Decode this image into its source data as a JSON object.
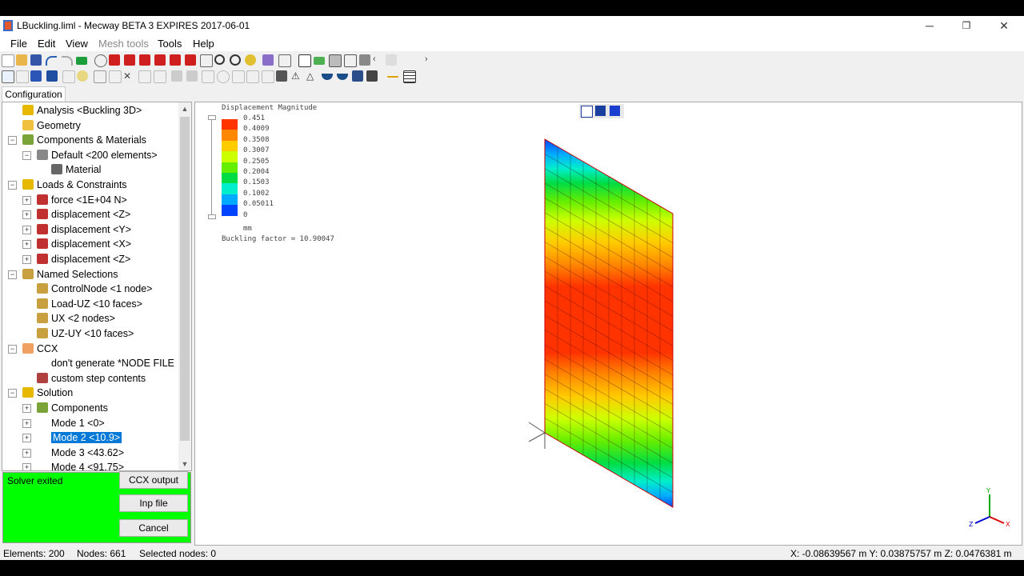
{
  "titlebar": {
    "title": "LBuckling.liml - Mecway BETA 3 EXPIRES 2017-06-01",
    "minimize": "─",
    "maximize": "❐",
    "close": "✕"
  },
  "menu": [
    "File",
    "Edit",
    "View",
    "Mesh tools",
    "Tools",
    "Help"
  ],
  "panel_tab": "Configuration",
  "tree": [
    {
      "label": "Analysis <Buckling 3D>",
      "icon": "analysis-icon"
    },
    {
      "label": "Geometry",
      "icon": "folder-icon"
    },
    {
      "label": "Components & Materials",
      "icon": "components-icon"
    },
    {
      "label": "Default <200 elements>",
      "icon": "component-icon"
    },
    {
      "label": "Material",
      "icon": "material-icon"
    },
    {
      "label": "Loads & Constraints",
      "icon": "loads-icon"
    },
    {
      "label": "force <1E+04 N>",
      "icon": "force-icon"
    },
    {
      "label": "displacement <Z>",
      "icon": "displacement-icon"
    },
    {
      "label": "displacement <Y>",
      "icon": "displacement-icon"
    },
    {
      "label": "displacement <X>",
      "icon": "displacement-icon"
    },
    {
      "label": "displacement <Z>",
      "icon": "displacement-icon"
    },
    {
      "label": "Named Selections",
      "icon": "named-selections-icon"
    },
    {
      "label": "ControlNode <1 node>",
      "icon": "selection-icon"
    },
    {
      "label": "Load-UZ <10 faces>",
      "icon": "selection-icon"
    },
    {
      "label": "UX <2 nodes>",
      "icon": "selection-icon"
    },
    {
      "label": "UZ-UY <10 faces>",
      "icon": "selection-icon"
    },
    {
      "label": "CCX",
      "icon": "ccx-icon"
    },
    {
      "label": "don't generate *NODE FILE",
      "icon": ""
    },
    {
      "label": "custom step contents",
      "icon": "custom-step-icon"
    },
    {
      "label": "Solution",
      "icon": "solution-icon"
    },
    {
      "label": "Components",
      "icon": "components-icon"
    },
    {
      "label": "Mode 1 <0>",
      "icon": ""
    },
    {
      "label": "Mode 2 <10.9>",
      "icon": ""
    },
    {
      "label": "Mode 3 <43.62>",
      "icon": ""
    },
    {
      "label": "Mode 4 <91.75>",
      "icon": ""
    }
  ],
  "solver": {
    "status": "Solver exited",
    "ccx_output": "CCX output",
    "inp_file": "Inp file",
    "cancel": "Cancel"
  },
  "legend": {
    "title": "Displacement Magnitude",
    "values": [
      "0.451",
      "0.4009",
      "0.3508",
      "0.3007",
      "0.2505",
      "0.2004",
      "0.1503",
      "0.1002",
      "0.05011",
      "0"
    ],
    "colors": [
      "#ff3300",
      "#ff8800",
      "#ffcc00",
      "#ccff00",
      "#66ee00",
      "#00dd44",
      "#00eecc",
      "#00aaff",
      "#0044ff"
    ],
    "unit": "mm",
    "buckling": "Buckling factor = 10.90047"
  },
  "triad": {
    "x": "X",
    "y": "Y",
    "z": "Z"
  },
  "status": {
    "elements": "Elements: 200",
    "nodes": "Nodes: 661",
    "selected": "Selected nodes: 0",
    "coords": "X: -0.08639567 m Y: 0.03875757 m Z: 0.0476381 m"
  }
}
